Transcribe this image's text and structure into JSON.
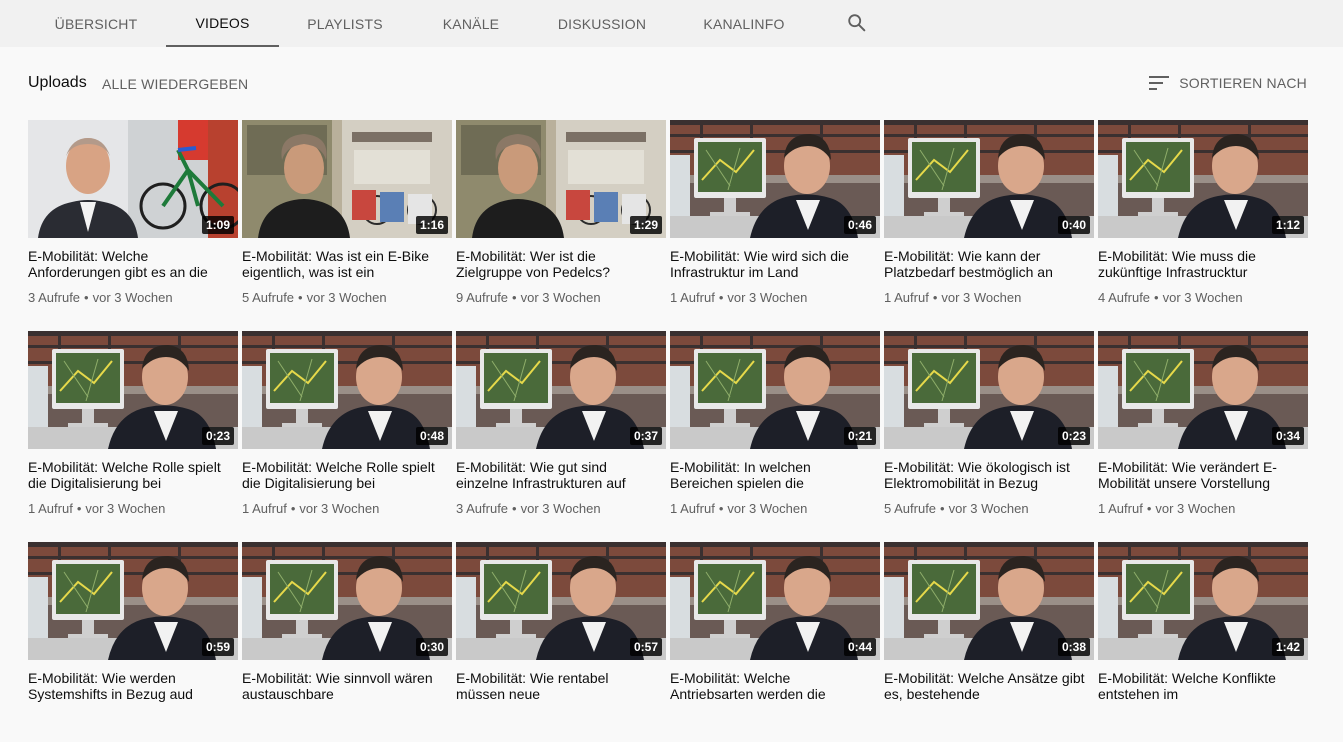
{
  "tabs": [
    {
      "label": "ÜBERSICHT",
      "active": false
    },
    {
      "label": "VIDEOS",
      "active": true
    },
    {
      "label": "PLAYLISTS",
      "active": false
    },
    {
      "label": "KANÄLE",
      "active": false
    },
    {
      "label": "DISKUSSION",
      "active": false
    },
    {
      "label": "KANALINFO",
      "active": false
    }
  ],
  "search_icon": "search-icon",
  "section": {
    "title": "Uploads",
    "play_all": "ALLE WIEDERGEBEN",
    "sort_label": "SORTIEREN NACH",
    "sort_icon": "sort-icon"
  },
  "colors": {
    "tabbar_bg": "#f1f1f1",
    "page_bg": "#f9f9f9",
    "secondary_text": "#606060",
    "duration_bg": "#000000"
  },
  "videos": [
    {
      "thumb": "shop-bike",
      "duration": "1:09",
      "title": "E-Mobilität: Welche Anforderungen gibt es an die",
      "views": "3 Aufrufe",
      "age": "vor 3 Wochen"
    },
    {
      "thumb": "shop-man",
      "duration": "1:16",
      "title": "E-Mobilität: Was ist ein E-Bike eigentlich, was ist ein",
      "views": "5 Aufrufe",
      "age": "vor 3 Wochen"
    },
    {
      "thumb": "shop-man",
      "duration": "1:29",
      "title": "E-Mobilität: Wer ist die Zielgruppe von Pedelcs?",
      "views": "9 Aufrufe",
      "age": "vor 3 Wochen"
    },
    {
      "thumb": "office",
      "duration": "0:46",
      "title": "E-Mobilität: Wie wird sich die Infrastruktur im Land",
      "views": "1 Aufruf",
      "age": "vor 3 Wochen"
    },
    {
      "thumb": "office",
      "duration": "0:40",
      "title": "E-Mobilität: Wie kann der Platzbedarf bestmöglich an",
      "views": "1 Aufruf",
      "age": "vor 3 Wochen"
    },
    {
      "thumb": "office",
      "duration": "1:12",
      "title": "E-Mobilität: Wie muss die zukünftige Infrastrucktur",
      "views": "4 Aufrufe",
      "age": "vor 3 Wochen"
    },
    {
      "thumb": "office",
      "duration": "0:23",
      "title": "E-Mobilität: Welche Rolle spielt die Digitalisierung bei",
      "views": "1 Aufruf",
      "age": "vor 3 Wochen"
    },
    {
      "thumb": "office",
      "duration": "0:48",
      "title": "E-Mobilität: Welche Rolle spielt die Digitalisierung bei",
      "views": "1 Aufruf",
      "age": "vor 3 Wochen"
    },
    {
      "thumb": "office",
      "duration": "0:37",
      "title": "E-Mobilität: Wie gut sind einzelne Infrastrukturen auf",
      "views": "3 Aufrufe",
      "age": "vor 3 Wochen"
    },
    {
      "thumb": "office",
      "duration": "0:21",
      "title": "E-Mobilität: In welchen Bereichen spielen die",
      "views": "1 Aufruf",
      "age": "vor 3 Wochen"
    },
    {
      "thumb": "office",
      "duration": "0:23",
      "title": "E-Mobilität: Wie ökologisch ist Elektromobilität in Bezug",
      "views": "5 Aufrufe",
      "age": "vor 3 Wochen"
    },
    {
      "thumb": "office",
      "duration": "0:34",
      "title": "E-Mobilität: Wie verändert E-Mobilität unsere Vorstellung",
      "views": "1 Aufruf",
      "age": "vor 3 Wochen"
    },
    {
      "thumb": "office",
      "duration": "0:59",
      "title": "E-Mobilität: Wie werden Systemshifts in Bezug aud",
      "views": "",
      "age": ""
    },
    {
      "thumb": "office",
      "duration": "0:30",
      "title": "E-Mobilität: Wie sinnvoll wären austauschbare",
      "views": "",
      "age": ""
    },
    {
      "thumb": "office",
      "duration": "0:57",
      "title": "E-Mobilität: Wie rentabel müssen neue",
      "views": "",
      "age": ""
    },
    {
      "thumb": "office",
      "duration": "0:44",
      "title": "E-Mobilität: Welche Antriebsarten werden die",
      "views": "",
      "age": ""
    },
    {
      "thumb": "office",
      "duration": "0:38",
      "title": "E-Mobilität: Welche Ansätze gibt es, bestehende",
      "views": "",
      "age": ""
    },
    {
      "thumb": "office",
      "duration": "1:42",
      "title": "E-Mobilität: Welche Konflikte entstehen im",
      "views": "",
      "age": ""
    }
  ]
}
